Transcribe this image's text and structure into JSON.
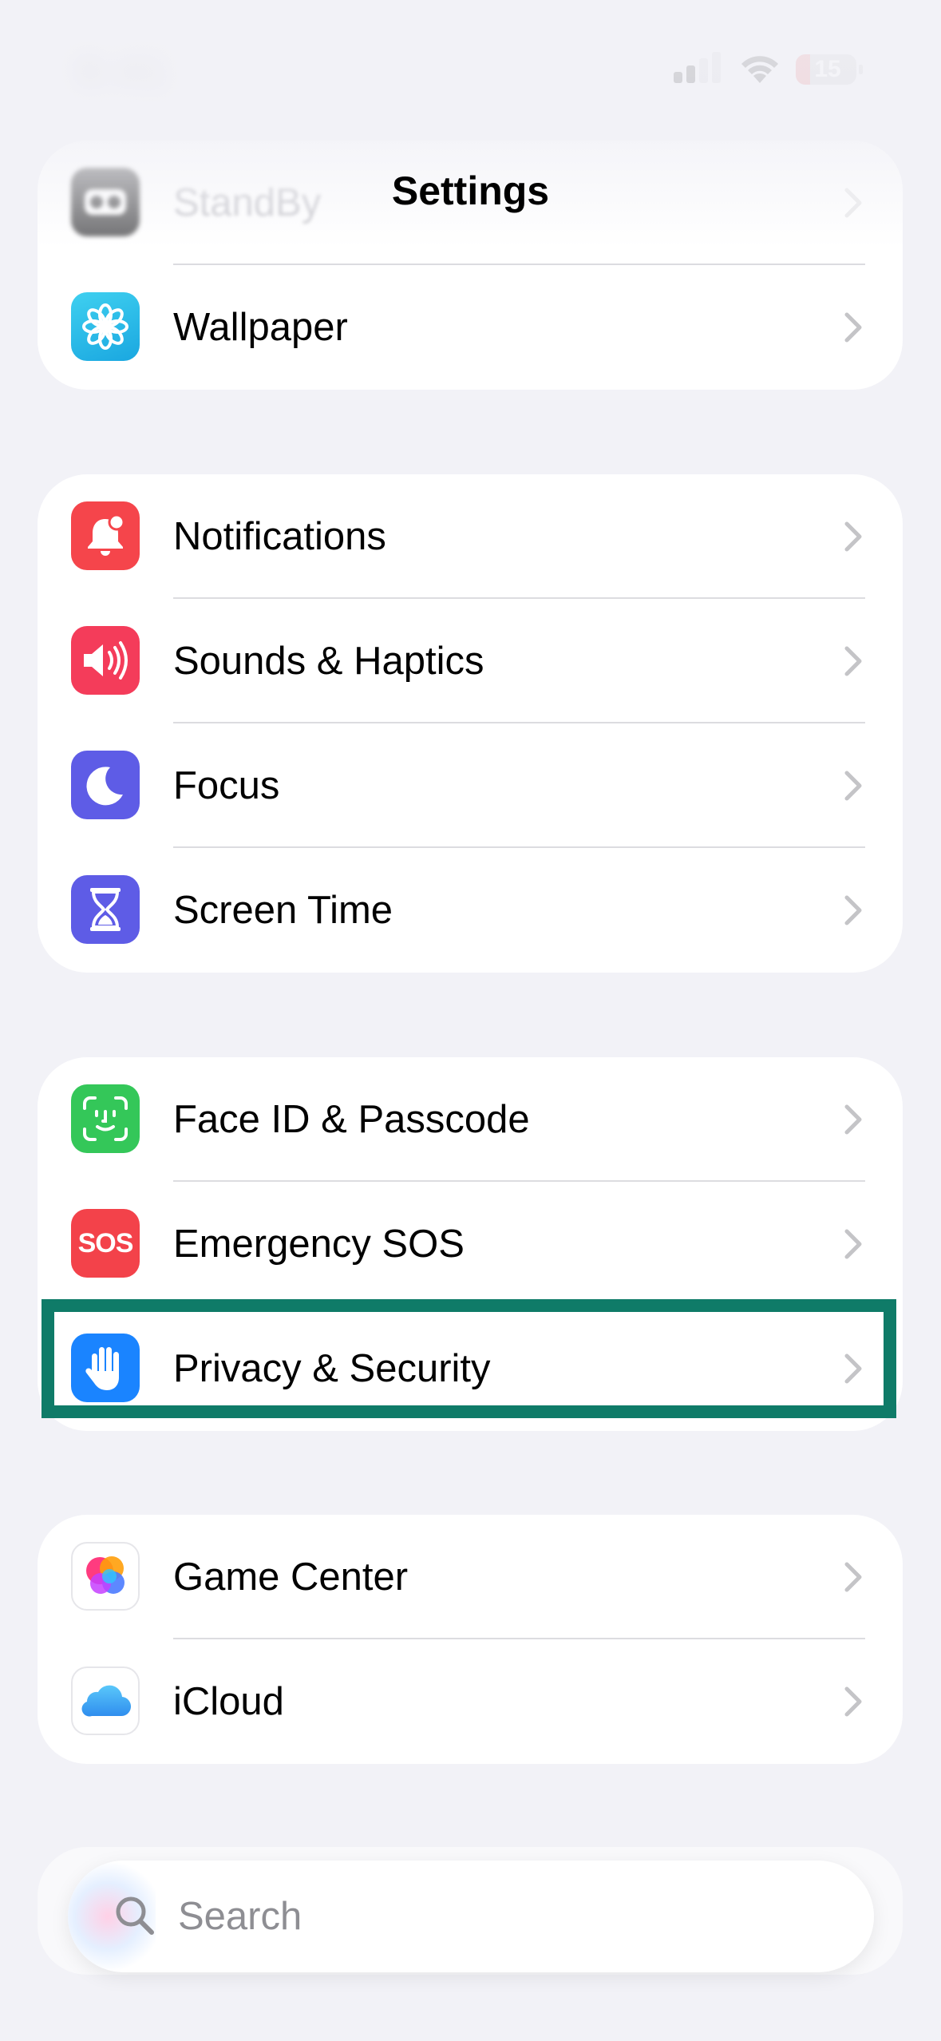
{
  "status_bar": {
    "time": "9:41",
    "battery_level": "15",
    "battery_color": "#e5484d"
  },
  "nav": {
    "title": "Settings"
  },
  "sections": [
    {
      "items": [
        {
          "label": "StandBy",
          "icon": "standby-icon",
          "icon_bg": "#1c1c1e"
        },
        {
          "label": "Wallpaper",
          "icon": "wallpaper-flower-icon",
          "icon_bg": "#2fc1e8"
        }
      ]
    },
    {
      "items": [
        {
          "label": "Notifications",
          "icon": "bell-icon",
          "icon_bg": "#f4434a"
        },
        {
          "label": "Sounds & Haptics",
          "icon": "speaker-icon",
          "icon_bg": "#f43c5a"
        },
        {
          "label": "Focus",
          "icon": "moon-icon",
          "icon_bg": "#5e5ce6"
        },
        {
          "label": "Screen Time",
          "icon": "hourglass-icon",
          "icon_bg": "#5e5ce6"
        }
      ]
    },
    {
      "items": [
        {
          "label": "Face ID & Passcode",
          "icon": "face-id-icon",
          "icon_bg": "#34c759"
        },
        {
          "label": "Emergency SOS",
          "icon": "sos-icon",
          "icon_bg": "#f3424a",
          "icon_text": "SOS"
        },
        {
          "label": "Privacy & Security",
          "icon": "hand-icon",
          "icon_bg": "#1a84ff"
        }
      ]
    },
    {
      "items": [
        {
          "label": "Game Center",
          "icon": "game-center-icon",
          "icon_bg": "#ffffff"
        },
        {
          "label": "iCloud",
          "icon": "cloud-icon",
          "icon_bg": "#ffffff"
        }
      ]
    }
  ],
  "search": {
    "placeholder": "Search"
  },
  "highlight_color": "#0f7b68"
}
